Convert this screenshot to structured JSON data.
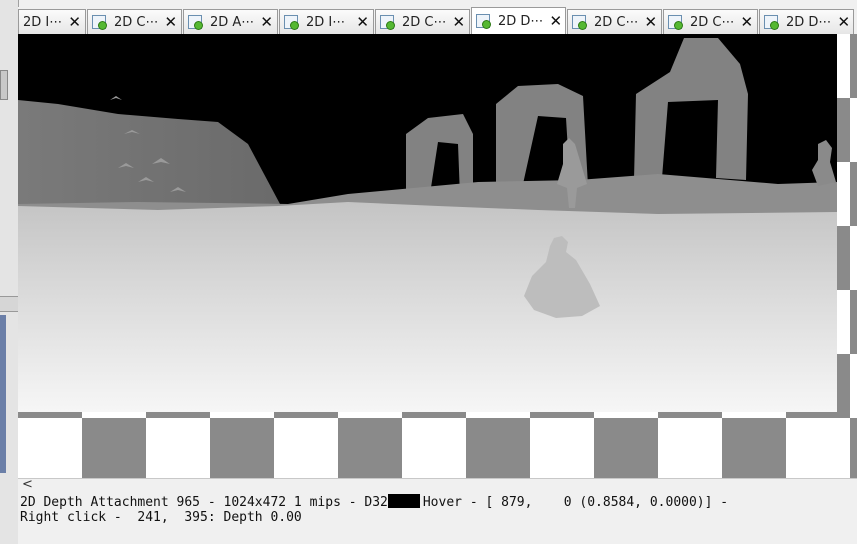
{
  "tabs": [
    {
      "label": "2D I⋯",
      "active": false,
      "has_icon": false
    },
    {
      "label": "2D C⋯",
      "active": false,
      "has_icon": true
    },
    {
      "label": "2D A⋯",
      "active": false,
      "has_icon": true
    },
    {
      "label": "2D I⋯",
      "active": false,
      "has_icon": true
    },
    {
      "label": "2D C⋯",
      "active": false,
      "has_icon": true
    },
    {
      "label": "2D D⋯",
      "active": true,
      "has_icon": true
    },
    {
      "label": "2D C⋯",
      "active": false,
      "has_icon": true
    },
    {
      "label": "2D C⋯",
      "active": false,
      "has_icon": true
    },
    {
      "label": "2D D⋯",
      "active": false,
      "has_icon": true
    }
  ],
  "tab_close_glyph": "✕",
  "scroll_arrow": "<",
  "status": {
    "line1_prefix": "2D Depth Attachment 965 - 1024x472 1 mips - D32",
    "line1_suffix": "Hover - [ 879,    0 (0.8584, 0.0000)] -",
    "line2": "Right click -  241,  395: Depth 0.00",
    "swatch_color": "#000000"
  },
  "colors": {
    "checker_dark": "#8a8a8a",
    "checker_light": "#ffffff",
    "tab_icon_accent": "#55b832"
  }
}
